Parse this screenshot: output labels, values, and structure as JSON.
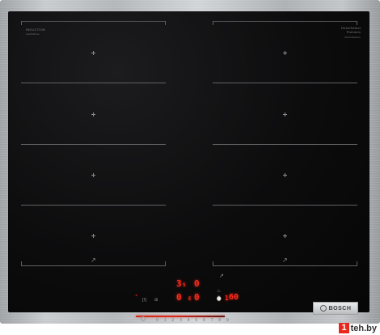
{
  "cooktop": {
    "zone_label_left": "INDUCTION",
    "zone_sublabel_left": "combiZone",
    "zone_label_right": "DirectSelect Premium",
    "zone_sublabel_right": "flexInduction",
    "flex_icon": "flex-zone-icon",
    "zones_per_side": 4
  },
  "display": {
    "left_top_digit": "3",
    "left_top_sub": "5",
    "left_top_level": "0",
    "left_bottom_digit": "0",
    "left_bottom_sub": "E",
    "left_bottom_level": "0",
    "timer_value": "60",
    "timer_prefix": "1",
    "led_color": "#ff2a1a"
  },
  "controls": {
    "lock_symbol": "[I]",
    "menu_text": "⊞",
    "clock_symbol": "⌚",
    "heat_symbol": "♨",
    "power_icon": "power-icon",
    "slider_digits": [
      "0",
      "1",
      "2",
      "3",
      "4",
      "5",
      "6",
      "7",
      "8",
      "9"
    ],
    "slider_level": 0.45
  },
  "brand": {
    "name": "BOSCH",
    "logo_icon": "bosch-armature-icon"
  },
  "watermark": {
    "highlight": "1",
    "text": "teh.by"
  }
}
